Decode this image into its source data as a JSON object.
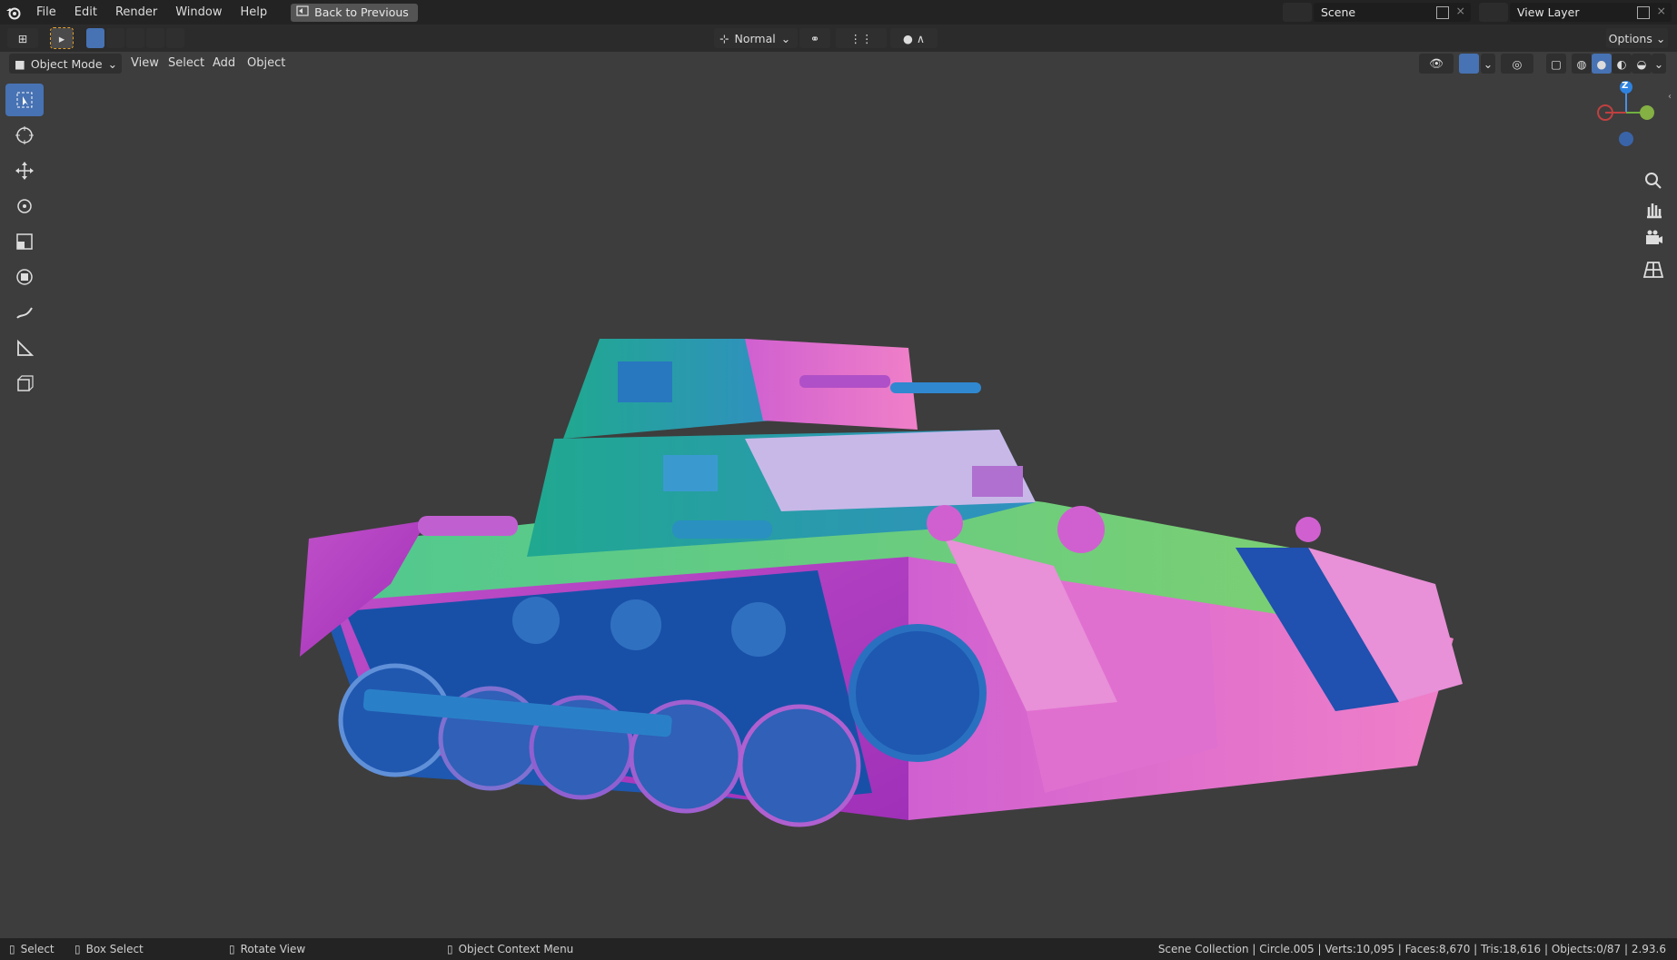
{
  "menu": [
    "File",
    "Edit",
    "Render",
    "Window",
    "Help"
  ],
  "back_button": "Back to Previous",
  "scene": {
    "label": "Scene"
  },
  "view_layer": {
    "label": "View Layer"
  },
  "toolbar": {
    "orientation": "Normal",
    "options": "Options"
  },
  "header": {
    "mode": "Object Mode",
    "menus": [
      "View",
      "Select",
      "Add",
      "Object"
    ]
  },
  "gizmo": {
    "z_label": "Z"
  },
  "status": {
    "select": "Select",
    "box_select": "Box Select",
    "rotate": "Rotate View",
    "context": "Object Context Menu",
    "stats": "Scene Collection | Circle.005 | Verts:10,095 | Faces:8,670 | Tris:18,616 | Objects:0/87 | 2.93.6"
  },
  "icons": [
    "blender-logo-icon",
    "back-icon",
    "select-icon",
    "cursor-icon",
    "move-icon",
    "rotate-icon",
    "scale-icon",
    "transform-icon",
    "annotate-icon",
    "measure-icon",
    "add-cube-icon",
    "zoom-icon",
    "hand-icon",
    "camera-icon",
    "grid-icon"
  ],
  "colors": {
    "accent": "#4772b3",
    "bg": "#3d3d3d",
    "topbar": "#232323"
  }
}
